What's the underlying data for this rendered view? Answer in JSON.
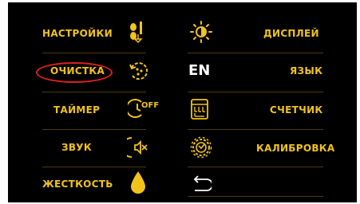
{
  "accent_color": "#f2c31a",
  "selection_color": "#e02020",
  "menu": {
    "left": [
      {
        "label": "НАСТРОЙКИ",
        "icon": "settings-sliders-icon"
      },
      {
        "label": "ОЧИСТКА",
        "icon": "cleaning-cycle-icon",
        "selected": true
      },
      {
        "label": "ТАЙМЕР",
        "icon": "timer-off-icon",
        "icon_text": "OFF"
      },
      {
        "label": "ЗВУК",
        "icon": "sound-mute-icon"
      },
      {
        "label": "ЖЕСТКОСТЬ",
        "icon": "water-drop-icon"
      }
    ],
    "right": [
      {
        "label": "ДИСПЛЕЙ",
        "icon": "brightness-icon"
      },
      {
        "label": "ЯЗЫК",
        "icon": "language-icon",
        "icon_text": "EN"
      },
      {
        "label": "СЧЕТЧИК",
        "icon": "counter-icon"
      },
      {
        "label": "КАЛИБРОВКА",
        "icon": "calibration-gear-icon"
      },
      {
        "label": "",
        "icon": "back-arrow-icon"
      }
    ]
  }
}
